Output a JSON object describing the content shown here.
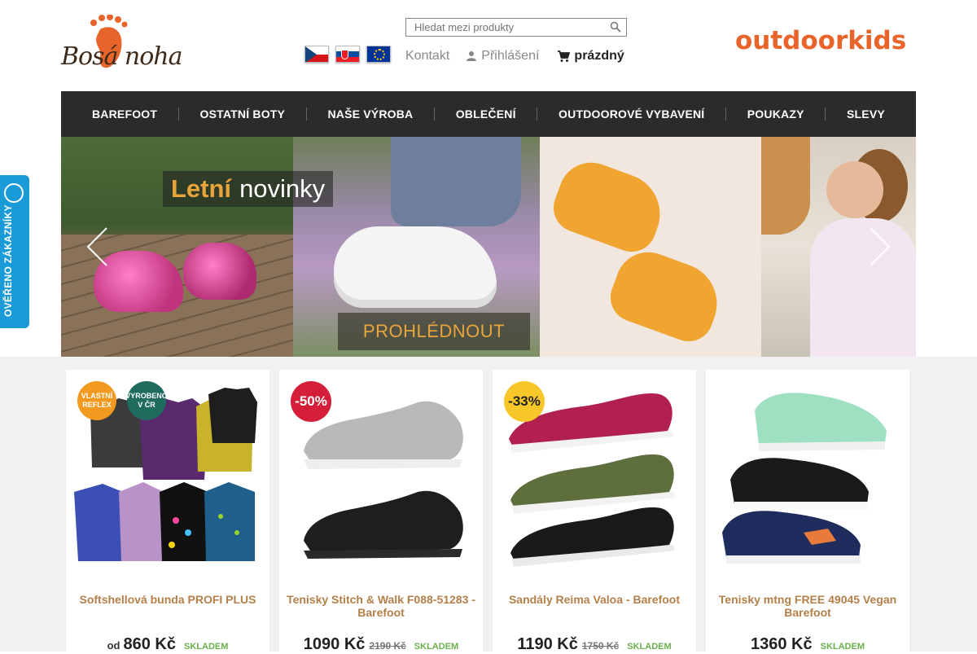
{
  "header": {
    "logo_text": "Bosá noha",
    "search_placeholder": "Hledat mezi produkty",
    "flags": [
      "Czech flag",
      "Slovak flag",
      "EU flag"
    ],
    "kontakt": "Kontakt",
    "login": "Přihlášení",
    "cart": "prázdný",
    "partner_logo": "outdoorkids",
    "accent_color": "#e8642a"
  },
  "nav": {
    "items": [
      "BAREFOOT",
      "OSTATNÍ BOTY",
      "NAŠE VÝROBA",
      "OBLEČENÍ",
      "OUTDOOROVÉ VYBAVENÍ",
      "POUKAZY",
      "SLEVY"
    ]
  },
  "banner": {
    "title_a": "Letní",
    "title_b": "novinky",
    "cta": "PROHLÉDNOUT"
  },
  "side_badge": {
    "text": "OVĚŘENO ZÁKAZNÍKY",
    "color": "#1a9bd7"
  },
  "products": [
    {
      "name": "Softshellová bunda PROFI PLUS",
      "price_prefix": "od",
      "price": "860 Kč",
      "old_price": "",
      "stock": "SKLADEM",
      "tag1": "VLASTNÍ REFLEX",
      "tag2": "VYROBENO V ČR"
    },
    {
      "name": "Tenisky Stitch & Walk F088-51283 - Barefoot",
      "price": "1090 Kč",
      "old_price": "2190 Kč",
      "stock": "SKLADEM",
      "discount": "-50%"
    },
    {
      "name": "Sandály Reima Valoa - Barefoot",
      "price": "1190 Kč",
      "old_price": "1750 Kč",
      "stock": "SKLADEM",
      "discount": "-33%"
    },
    {
      "name": "Tenisky mtng FREE 49045 Vegan Barefoot",
      "price": "1360 Kč",
      "old_price": "",
      "stock": "SKLADEM"
    }
  ]
}
